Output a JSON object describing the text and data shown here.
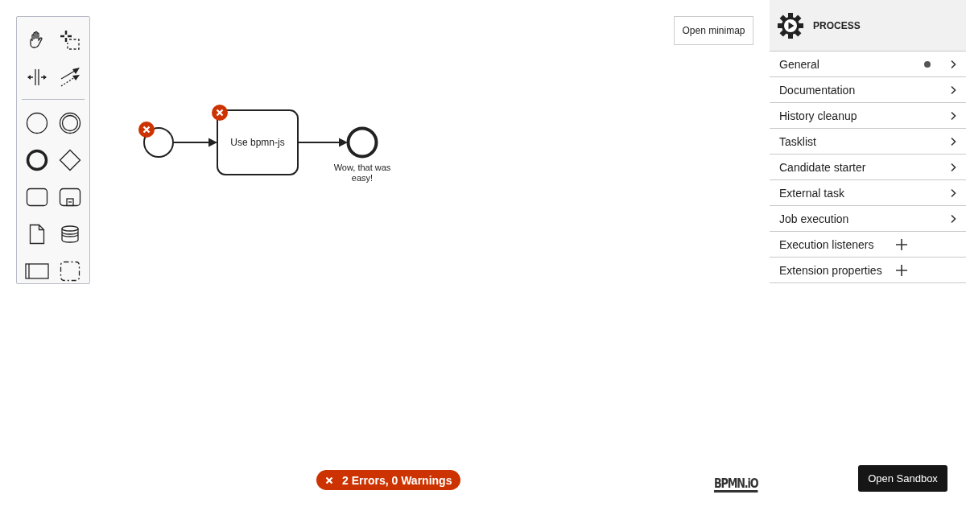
{
  "minimap_button": "Open minimap",
  "diagram": {
    "start_event": {
      "has_error": true
    },
    "task": {
      "label": "Use bpmn-js",
      "has_error": true
    },
    "end_event": {
      "label": "Wow, that was easy!"
    }
  },
  "panel": {
    "title": "PROCESS",
    "groups": [
      {
        "label": "General",
        "kind": "collapsible",
        "has_entries": true
      },
      {
        "label": "Documentation",
        "kind": "collapsible",
        "has_entries": false
      },
      {
        "label": "History cleanup",
        "kind": "collapsible",
        "has_entries": false
      },
      {
        "label": "Tasklist",
        "kind": "collapsible",
        "has_entries": false
      },
      {
        "label": "Candidate starter",
        "kind": "collapsible",
        "has_entries": false
      },
      {
        "label": "External task",
        "kind": "collapsible",
        "has_entries": false
      },
      {
        "label": "Job execution",
        "kind": "collapsible",
        "has_entries": false
      },
      {
        "label": "Execution listeners",
        "kind": "list"
      },
      {
        "label": "Extension properties",
        "kind": "list"
      }
    ]
  },
  "status": {
    "label": "2 Errors, 0 Warnings"
  },
  "logo": "BPMN.iO",
  "sandbox_button": "Open Sandbox"
}
